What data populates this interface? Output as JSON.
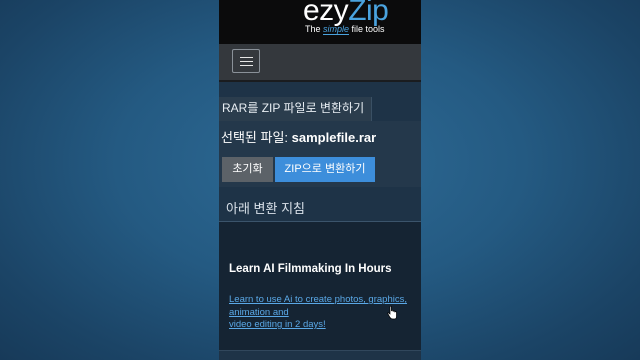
{
  "header": {
    "logo_ezy": "ezy",
    "logo_zip": "Zip",
    "tagline_pre": "The ",
    "tagline_simple": "simple",
    "tagline_post": " file tools"
  },
  "nav": {
    "menu_icon": "hamburger-menu-icon"
  },
  "page": {
    "title": "RAR를 ZIP 파일로 변환하기"
  },
  "file": {
    "label": "선택된 파일: ",
    "name": "samplefile.rar"
  },
  "buttons": {
    "reset": "초기화",
    "convert": "ZIP으로 변환하기"
  },
  "section": {
    "title": "아래 변환 지침"
  },
  "ad": {
    "title": "Learn AI Filmmaking In Hours",
    "link_text": "Learn to use Ai to create photos, graphics, animation and\nvideo editing in 2 days!"
  },
  "colors": {
    "accent": "#4aa3df",
    "button_primary": "#3d8edb",
    "button_secondary": "#5c6268"
  }
}
